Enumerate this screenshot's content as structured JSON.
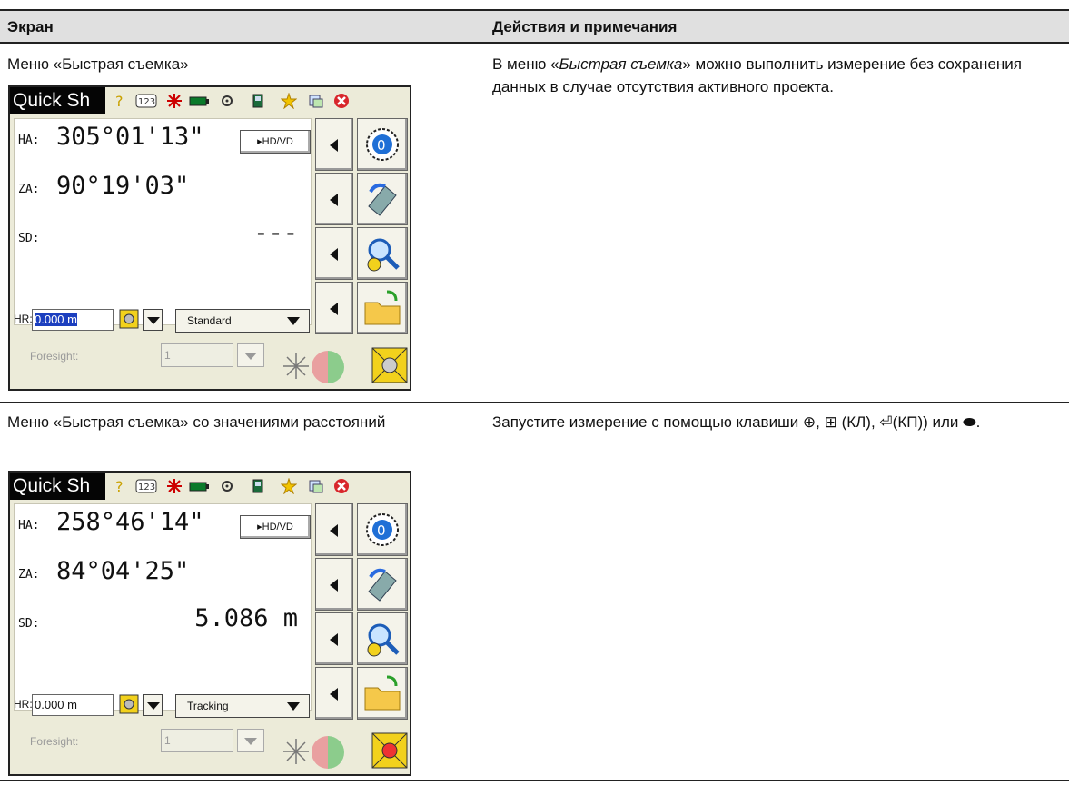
{
  "table": {
    "header": {
      "col1": "Экран",
      "col2": "Действия и примечания"
    },
    "rows": [
      {
        "caption": "Меню «Быстрая съемка»",
        "notes_pre": "В меню «",
        "notes_em": "Быстрая съемка",
        "notes_post": "» можно выполнить измерение без сохранения данных в случае отсутствия активного проекта.",
        "screen": {
          "title": "Quick Sh",
          "ha_label": "HA:",
          "ha_value": "305°01'13\"",
          "za_label": "ZA:",
          "za_value": "90°19'03\"",
          "sd_label": "SD:",
          "sd_value": "---",
          "hd_button": "▸HD/VD",
          "hr_label": "HR:",
          "hr_value": "0.000 m",
          "mode": "Standard",
          "foresight_label": "Foresight:",
          "foresight_value": "1"
        }
      },
      {
        "caption": "Меню «Быстрая съемка» со значениями расстояний",
        "notes": "Запустите измерение с помощью клавиши ⊕, ⊞ (КЛ), ⏎(КП)) или ⬬.",
        "screen": {
          "title": "Quick Sh",
          "ha_label": "HA:",
          "ha_value": "258°46'14\"",
          "za_label": "ZA:",
          "za_value": "84°04'25\"",
          "sd_label": "SD:",
          "sd_value": "5.086 m",
          "hd_button": "▸HD/VD",
          "hr_label": "HR:",
          "hr_value": "0.000 m",
          "mode": "Tracking",
          "foresight_label": "Foresight:",
          "foresight_value": "1"
        }
      }
    ]
  },
  "colors": {
    "header_bg": "#e0e0e0",
    "screen_bg": "#ecebd9",
    "title_bg": "#050505",
    "selection": "#1c3fbf"
  }
}
